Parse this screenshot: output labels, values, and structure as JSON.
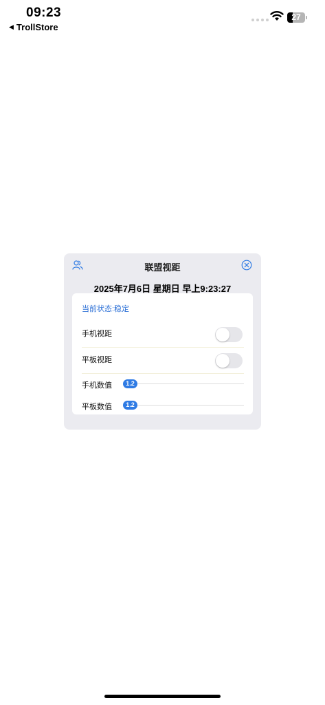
{
  "status_bar": {
    "time": "09:23",
    "back_app": "TrollStore",
    "battery_level": "27"
  },
  "panel": {
    "title": "联盟视距",
    "datetime": "2025年7月6日 星期日 早上9:23:27",
    "status": "当前状态:稳定",
    "toggles": [
      {
        "label": "手机视距",
        "on": false
      },
      {
        "label": "平板视距",
        "on": false
      }
    ],
    "sliders": [
      {
        "label": "手机数值",
        "value": "1.2"
      },
      {
        "label": "平板数值",
        "value": "1.2"
      }
    ]
  },
  "colors": {
    "accent": "#2f7be4",
    "status_text": "#2b6fd6",
    "panel_bg": "#ebebf0"
  }
}
